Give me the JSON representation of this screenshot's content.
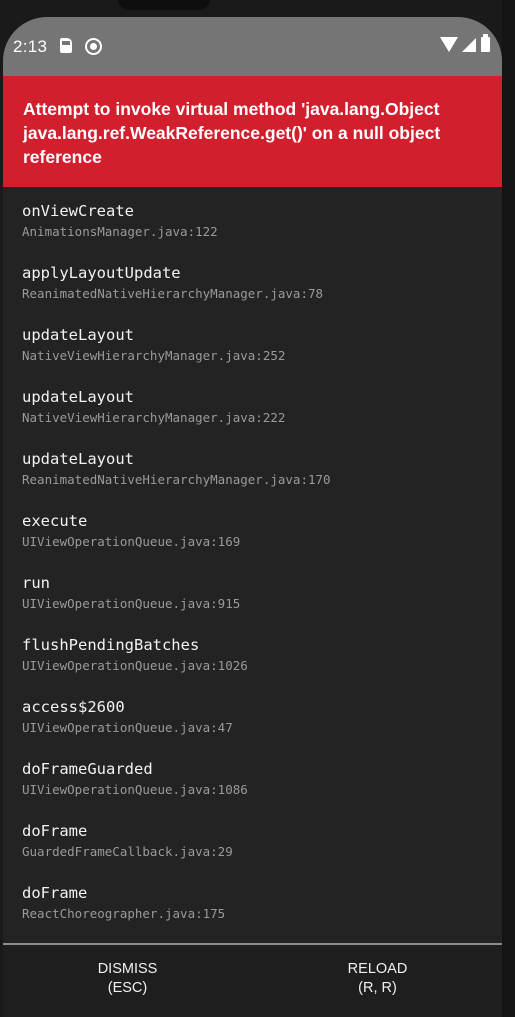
{
  "status_bar": {
    "time": "2:13",
    "icons": [
      "sim-card-icon",
      "sync-icon",
      "wifi-icon",
      "signal-icon",
      "battery-icon"
    ]
  },
  "error": {
    "message": "Attempt to invoke virtual method 'java.lang.Object java.lang.ref.WeakReference.get()' on a null object reference",
    "header_color": "#d21f2d"
  },
  "stack": [
    {
      "method": "onViewCreate",
      "location": "AnimationsManager.java:122"
    },
    {
      "method": "applyLayoutUpdate",
      "location": "ReanimatedNativeHierarchyManager.java:78"
    },
    {
      "method": "updateLayout",
      "location": "NativeViewHierarchyManager.java:252"
    },
    {
      "method": "updateLayout",
      "location": "NativeViewHierarchyManager.java:222"
    },
    {
      "method": "updateLayout",
      "location": "ReanimatedNativeHierarchyManager.java:170"
    },
    {
      "method": "execute",
      "location": "UIViewOperationQueue.java:169"
    },
    {
      "method": "run",
      "location": "UIViewOperationQueue.java:915"
    },
    {
      "method": "flushPendingBatches",
      "location": "UIViewOperationQueue.java:1026"
    },
    {
      "method": "access$2600",
      "location": "UIViewOperationQueue.java:47"
    },
    {
      "method": "doFrameGuarded",
      "location": "UIViewOperationQueue.java:1086"
    },
    {
      "method": "doFrame",
      "location": "GuardedFrameCallback.java:29"
    },
    {
      "method": "doFrame",
      "location": "ReactChoreographer.java:175"
    }
  ],
  "footer": {
    "dismiss": {
      "label": "DISMISS",
      "shortcut": "(ESC)"
    },
    "reload": {
      "label": "RELOAD",
      "shortcut": "(R, R)"
    }
  }
}
